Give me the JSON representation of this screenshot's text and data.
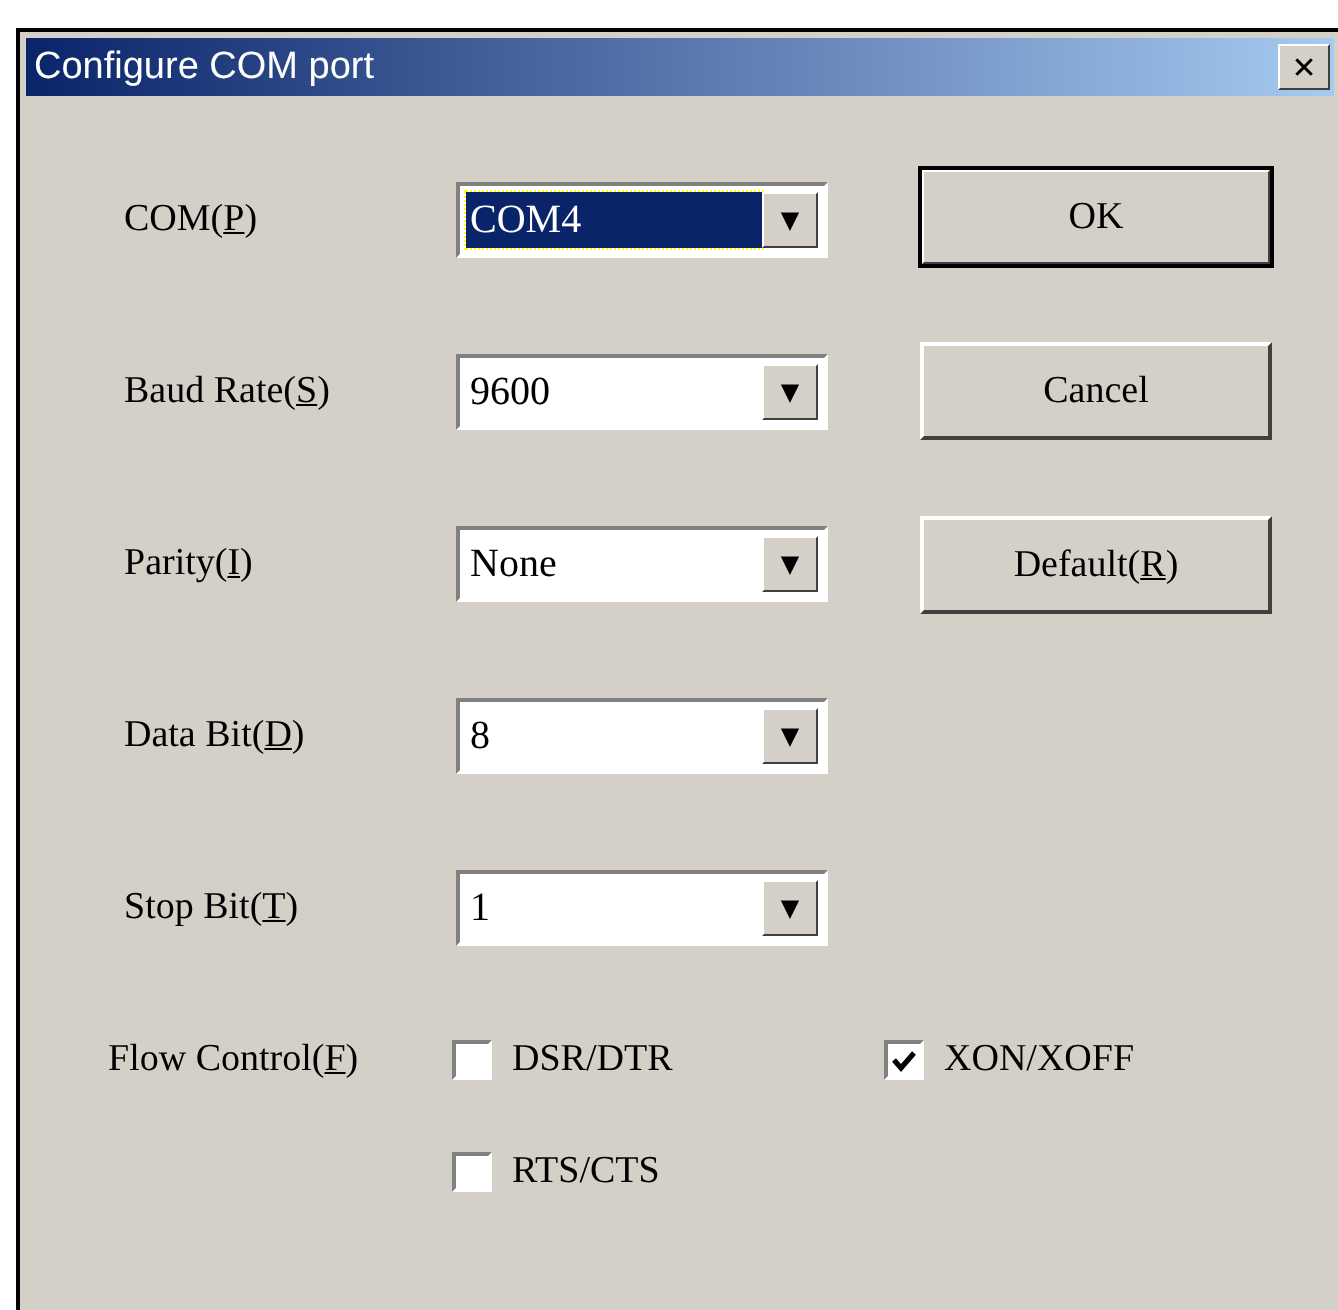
{
  "window": {
    "title": "Configure COM port",
    "close": "✕"
  },
  "fields": [
    {
      "label": {
        "before": "COM(",
        "key": "P",
        "after": ")"
      },
      "value": "COM4",
      "highlighted": true,
      "arrow": "▼"
    },
    {
      "label": {
        "before": "Baud Rate(",
        "key": "S",
        "after": ")"
      },
      "value": "9600",
      "highlighted": false,
      "arrow": "▼"
    },
    {
      "label": {
        "before": "Parity(",
        "key": "I",
        "after": ")"
      },
      "value": "None",
      "highlighted": false,
      "arrow": "▼"
    },
    {
      "label": {
        "before": "Data Bit(",
        "key": "D",
        "after": ")"
      },
      "value": "8",
      "highlighted": false,
      "arrow": "▼"
    },
    {
      "label": {
        "before": "Stop Bit(",
        "key": "T",
        "after": ")"
      },
      "value": "1",
      "highlighted": false,
      "arrow": "▼"
    }
  ],
  "buttons": [
    {
      "label": {
        "before": "OK"
      },
      "default": true
    },
    {
      "label": {
        "before": "Cancel"
      },
      "default": false
    },
    {
      "label": {
        "before": "Default(",
        "key": "R",
        "after": ")"
      },
      "default": false
    }
  ],
  "flow_control": {
    "label": {
      "before": "Flow Control(",
      "key": "F",
      "after": ")"
    },
    "options": [
      {
        "label": "DSR/DTR",
        "checked": false
      },
      {
        "label": "XON/XOFF",
        "checked": true
      },
      {
        "label": "RTS/CTS",
        "checked": false
      }
    ]
  }
}
